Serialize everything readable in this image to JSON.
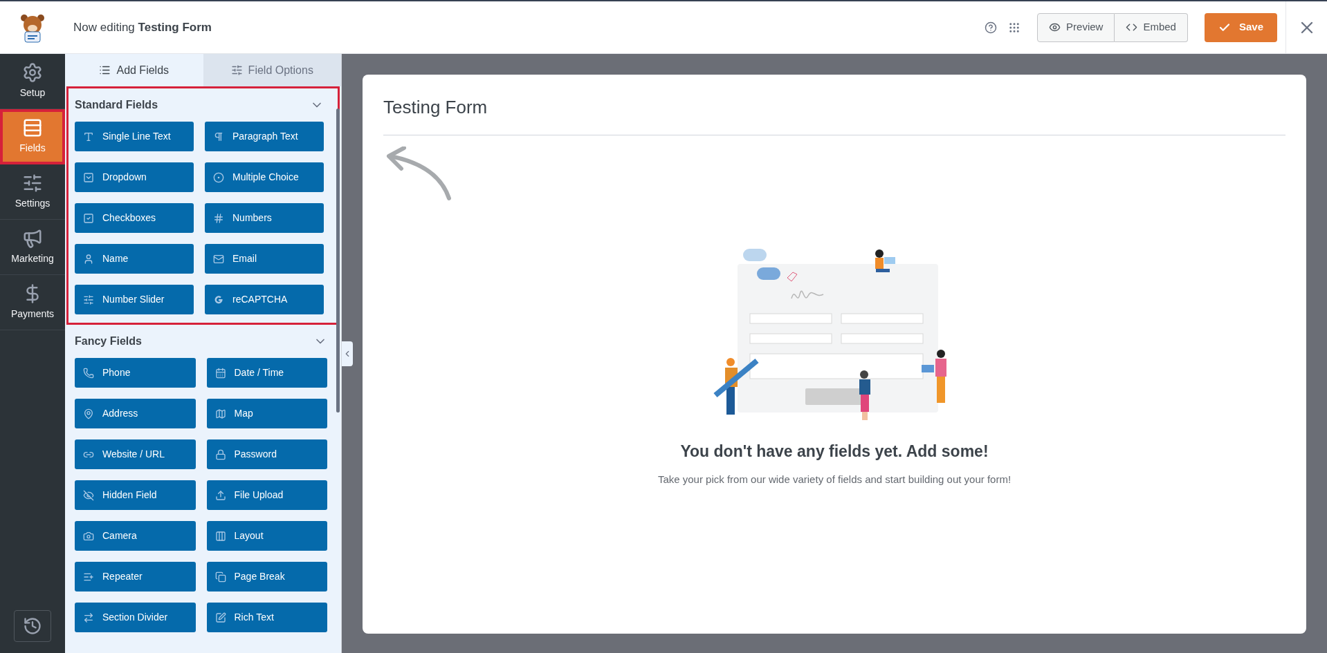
{
  "header": {
    "prefix": "Now editing",
    "form_name": "Testing Form",
    "actions": [
      {
        "kind": "help"
      },
      {
        "kind": "apps"
      }
    ],
    "buttons": [
      {
        "kind": "preview",
        "label": "Preview"
      },
      {
        "kind": "embed",
        "label": "Embed"
      },
      {
        "kind": "save",
        "label": "Save"
      }
    ]
  },
  "nav": [
    {
      "label": "Setup",
      "selected": false,
      "highlighted": false
    },
    {
      "label": "Fields",
      "selected": true,
      "highlighted": true
    },
    {
      "label": "Settings",
      "selected": false,
      "highlighted": false
    },
    {
      "label": "Marketing",
      "selected": false,
      "highlighted": false
    },
    {
      "label": "Payments",
      "selected": false,
      "highlighted": false
    }
  ],
  "panel_tabs": [
    {
      "label": "Add Fields",
      "selected": true
    },
    {
      "label": "Field Options",
      "selected": false
    }
  ],
  "sections": [
    {
      "title": "Standard Fields",
      "expanded": true,
      "highlighted": true,
      "fields": [
        "Single Line Text",
        "Paragraph Text",
        "Dropdown",
        "Multiple Choice",
        "Checkboxes",
        "Numbers",
        "Name",
        "Email",
        "Number Slider",
        "reCAPTCHA"
      ]
    },
    {
      "title": "Fancy Fields",
      "expanded": true,
      "highlighted": false,
      "fields": [
        "Phone",
        "Date / Time",
        "Address",
        "Map",
        "Website / URL",
        "Password",
        "Hidden Field",
        "File Upload",
        "Camera",
        "Layout",
        "Repeater",
        "Page Break",
        "Section Divider",
        "Rich Text"
      ]
    }
  ],
  "canvas": {
    "title": "Testing Form",
    "empty_title": "You don't have any fields yet. Add some!",
    "empty_text": "Take your pick from our wide variety of fields and start building out your form!"
  }
}
